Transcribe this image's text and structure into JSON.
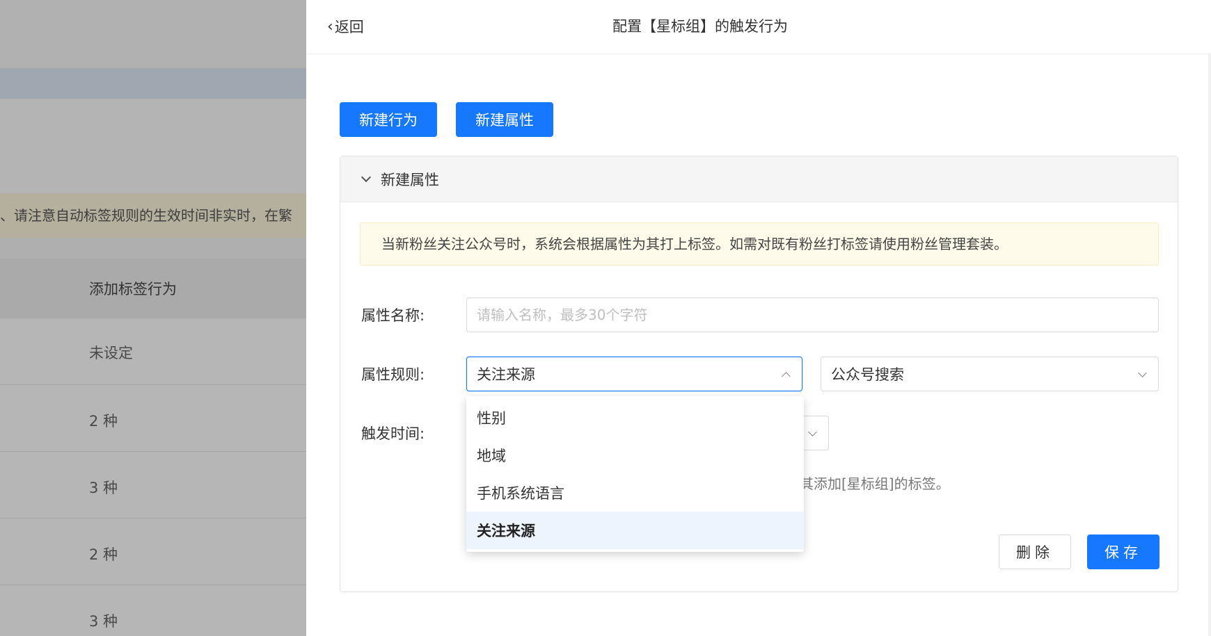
{
  "background": {
    "notice_text": "、请注意自动标签规则的生效时间非实时，在繁",
    "table_header": "添加标签行为",
    "rows": [
      "未设定",
      "2 种",
      "3 种",
      "2 种",
      "3 种"
    ]
  },
  "drawer": {
    "back_label": "返回",
    "title": "配置【星标组】的触发行为",
    "new_behavior_label": "新建行为",
    "new_attribute_label": "新建属性",
    "panel": {
      "title": "新建属性",
      "alert": "当新粉丝关注公众号时，系统会根据属性为其打上标签。如需对既有粉丝打标签请使用粉丝管理套装。",
      "name_label": "属性名称:",
      "name_placeholder": "请输入名称，最多30个字符",
      "rule_label": "属性规则:",
      "rule_value": "关注来源",
      "source_value": "公众号搜索",
      "time_label": "触发时间:",
      "hint": "其添加[星标组]的标签。",
      "delete_label": "删除",
      "save_label": "保存"
    },
    "dropdown_options": [
      "性别",
      "地域",
      "手机系统语言",
      "关注来源"
    ],
    "dropdown_selected": "关注来源"
  },
  "colors": {
    "primary": "#1677ff",
    "alert_bg": "#fffbea",
    "selected_bg": "#eef4fd"
  }
}
